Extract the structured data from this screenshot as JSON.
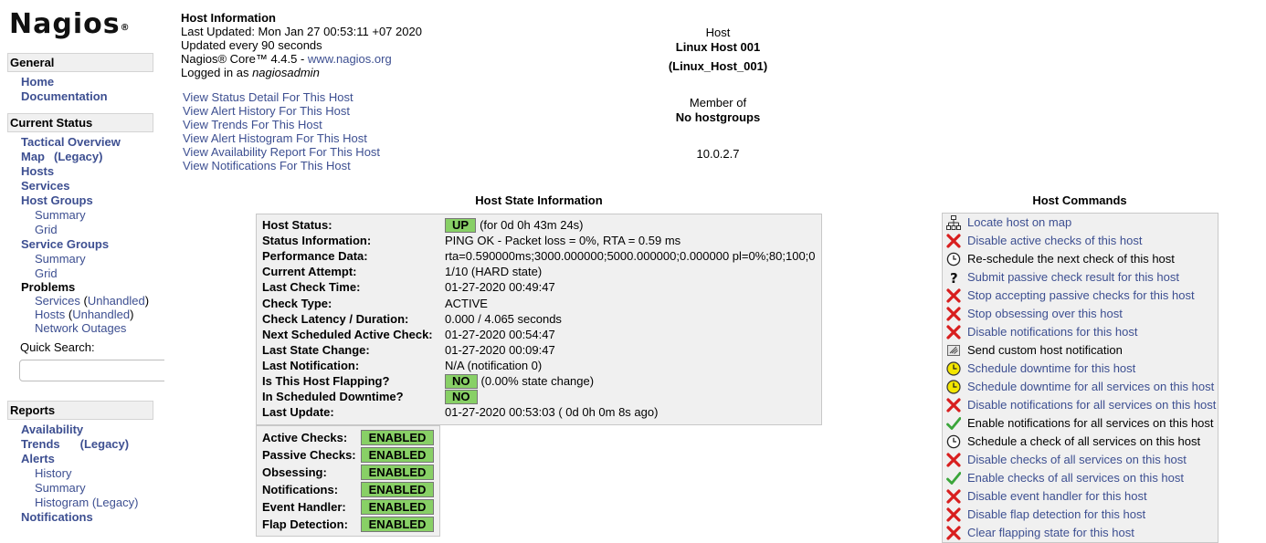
{
  "logo": {
    "text": "Nagios",
    "mark": "®"
  },
  "sidebar": {
    "general": {
      "title": "General",
      "items": [
        "Home",
        "Documentation"
      ]
    },
    "current_status": {
      "title": "Current Status",
      "tactical": "Tactical Overview",
      "map": "Map",
      "map_legacy": "(Legacy)",
      "hosts": "Hosts",
      "services": "Services",
      "host_groups": "Host Groups",
      "hg_summary": "Summary",
      "hg_grid": "Grid",
      "service_groups": "Service Groups",
      "sg_summary": "Summary",
      "sg_grid": "Grid",
      "problems": "Problems",
      "prob_services": "Services",
      "prob_hosts": "Hosts",
      "unhandled": "Unhandled",
      "network_outages": "Network Outages",
      "quick_search_label": "Quick Search:"
    },
    "reports": {
      "title": "Reports",
      "availability": "Availability",
      "trends": "Trends",
      "trends_legacy": "(Legacy)",
      "alerts": "Alerts",
      "history": "History",
      "summary": "Summary",
      "histogram": "Histogram (Legacy)",
      "notifications": "Notifications"
    }
  },
  "info": {
    "title": "Host Information",
    "last_updated": "Last Updated: Mon Jan 27 00:53:11 +07 2020",
    "update_every": "Updated every 90 seconds",
    "core_prefix": "Nagios® Core™ 4.4.5 - ",
    "core_link": "www.nagios.org",
    "logged_prefix": "Logged in as ",
    "user": "nagiosadmin",
    "links": [
      "View Status Detail For This Host",
      "View Alert History For This Host",
      "View Trends For This Host",
      "View Alert Histogram For This Host",
      "View Availability Report For This Host",
      "View Notifications For This Host"
    ]
  },
  "host": {
    "label": "Host",
    "name": "Linux Host 001",
    "id": "(Linux_Host_001)",
    "member_label": "Member of",
    "member_value": "No hostgroups",
    "address": "10.0.2.7"
  },
  "state": {
    "title": "Host State Information",
    "rows": [
      {
        "k": "Host Status:",
        "badge": "UP",
        "v": "(for 0d 0h 43m 24s)"
      },
      {
        "k": "Status Information:",
        "v": "PING OK - Packet loss = 0%, RTA = 0.59 ms"
      },
      {
        "k": "Performance Data:",
        "v": "rta=0.590000ms;3000.000000;5000.000000;0.000000 pl=0%;80;100;0"
      },
      {
        "k": "Current Attempt:",
        "v": "1/10  (HARD state)"
      },
      {
        "k": "Last Check Time:",
        "v": "01-27-2020 00:49:47"
      },
      {
        "k": "Check Type:",
        "v": "ACTIVE"
      },
      {
        "k": "Check Latency / Duration:",
        "v": "0.000 / 4.065 seconds"
      },
      {
        "k": "Next Scheduled Active Check:",
        "v": "01-27-2020 00:54:47"
      },
      {
        "k": "Last State Change:",
        "v": "01-27-2020 00:09:47"
      },
      {
        "k": "Last Notification:",
        "v": "N/A (notification 0)"
      },
      {
        "k": "Is This Host Flapping?",
        "badge": "NO",
        "v": "(0.00% state change)"
      },
      {
        "k": "In Scheduled Downtime?",
        "badge": "NO",
        "v": ""
      },
      {
        "k": "Last Update:",
        "v": "01-27-2020 00:53:03  ( 0d 0h 0m 8s ago)"
      }
    ],
    "checks": [
      {
        "k": "Active Checks:",
        "v": "ENABLED"
      },
      {
        "k": "Passive Checks:",
        "v": "ENABLED"
      },
      {
        "k": "Obsessing:",
        "v": "ENABLED"
      },
      {
        "k": "Notifications:",
        "v": "ENABLED"
      },
      {
        "k": "Event Handler:",
        "v": "ENABLED"
      },
      {
        "k": "Flap Detection:",
        "v": "ENABLED"
      }
    ]
  },
  "commands": {
    "title": "Host Commands",
    "items": [
      {
        "icon": "map",
        "text": "Locate host on map"
      },
      {
        "icon": "x",
        "text": "Disable active checks of this host"
      },
      {
        "icon": "clock",
        "text": "Re-schedule the next check of this host"
      },
      {
        "icon": "question",
        "text": "Submit passive check result for this host"
      },
      {
        "icon": "x",
        "text": "Stop accepting passive checks for this host"
      },
      {
        "icon": "x",
        "text": "Stop obsessing over this host"
      },
      {
        "icon": "x",
        "text": "Disable notifications for this host"
      },
      {
        "icon": "note",
        "text": "Send custom host notification"
      },
      {
        "icon": "downtime",
        "text": "Schedule downtime for this host"
      },
      {
        "icon": "downtime",
        "text": "Schedule downtime for all services on this host"
      },
      {
        "icon": "x",
        "text": "Disable notifications for all services on this host"
      },
      {
        "icon": "check",
        "text": "Enable notifications for all services on this host"
      },
      {
        "icon": "clock",
        "text": "Schedule a check of all services on this host"
      },
      {
        "icon": "x",
        "text": "Disable checks of all services on this host"
      },
      {
        "icon": "check",
        "text": "Enable checks of all services on this host"
      },
      {
        "icon": "x",
        "text": "Disable event handler for this host"
      },
      {
        "icon": "x",
        "text": "Disable flap detection for this host"
      },
      {
        "icon": "x",
        "text": "Clear flapping state for this host"
      }
    ]
  },
  "colors": {
    "link": "#3d4f91",
    "badge_green": "#88d066",
    "panel": "#f0f0f0",
    "error_red": "#d81e1e"
  }
}
